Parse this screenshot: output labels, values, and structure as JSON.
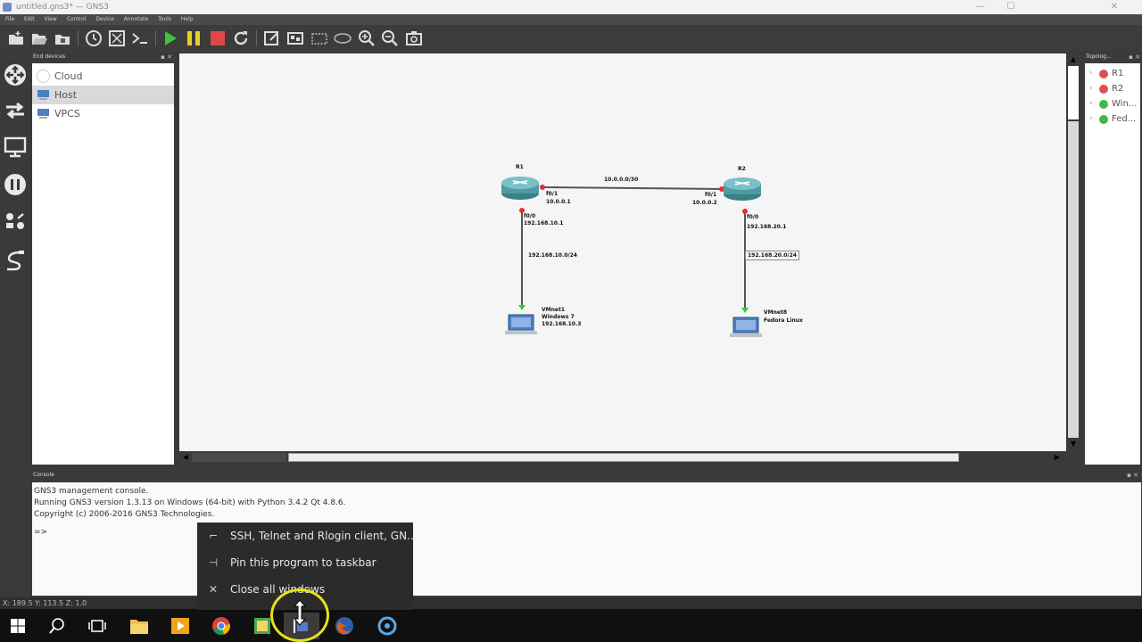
{
  "window": {
    "title": "untitled.gns3* — GNS3",
    "min_symbol": "—",
    "max_symbol": "☐",
    "close_symbol": "✕"
  },
  "menu": [
    "File",
    "Edit",
    "View",
    "Control",
    "Device",
    "Annotate",
    "Tools",
    "Help"
  ],
  "panels": {
    "end_devices_title": "End devices",
    "topology_title": "Topolog...",
    "console_title": "Console",
    "dock_buttons": "▪ ✕"
  },
  "end_devices": [
    {
      "label": "Cloud",
      "icon": "cloud-icon"
    },
    {
      "label": "Host",
      "icon": "host-icon",
      "selected": true
    },
    {
      "label": "VPCS",
      "icon": "vpcs-icon"
    }
  ],
  "topology": [
    {
      "label": "R1",
      "status_color": "#e05050"
    },
    {
      "label": "R2",
      "status_color": "#e05050"
    },
    {
      "label": "Win...",
      "status_color": "#44b844"
    },
    {
      "label": "Fed...",
      "status_color": "#44b844"
    }
  ],
  "diagram": {
    "r1_name": "R1",
    "r2_name": "R2",
    "link_r1_r2": "10.0.0.0/30",
    "r1_f01_if": "f0/1",
    "r1_f01_ip": "10.0.0.1",
    "r2_f01_if": "f0/1",
    "r2_f01_ip": "10.0.0.2",
    "r1_f00_if": "f0/0",
    "r1_f00_ip": "192.168.10.1",
    "r2_f00_if": "f0/0",
    "r2_f00_ip": "192.168.20.1",
    "net_left": "192.168.10.0/24",
    "net_right": "192.168.20.0/24",
    "host1_if": "VMnet1",
    "host1_os": "Windows 7",
    "host1_ip": "192.168.10.3",
    "host2_if": "VMnet8",
    "host2_os": "Fedora Linux",
    "router_color": "#4f9aa3",
    "link_color": "#555555",
    "port_up_color": "#e03030",
    "port_ok_color": "#33cc33"
  },
  "console": {
    "lines": [
      "GNS3 management console.",
      "Running GNS3 version 1.3.13 on Windows (64-bit) with Python 3.4.2 Qt 4.8.6.",
      "Copyright (c) 2006-2016 GNS3 Technologies."
    ],
    "prompt": "=>"
  },
  "status": "X: 189.5 Y: 113.5 Z: 1.0",
  "jumplist": [
    {
      "label": "SSH, Telnet and Rlogin client, GN...",
      "icon": "terminal-app-icon"
    },
    {
      "label": "Pin this program to taskbar",
      "icon": "pin-icon"
    },
    {
      "label": "Close all windows",
      "icon": "close-icon"
    }
  ]
}
